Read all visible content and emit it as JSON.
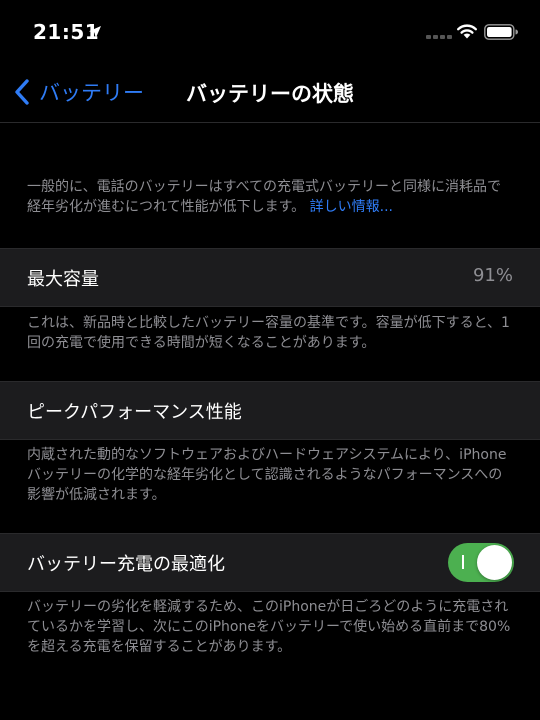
{
  "status_bar": {
    "time": "21:51"
  },
  "nav": {
    "back_label": "バッテリー",
    "title": "バッテリーの状態"
  },
  "intro": {
    "text": "一般的に、電話のバッテリーはすべての充電式バッテリーと同様に消耗品で経年劣化が進むにつれて性能が低下します。",
    "link": "詳しい情報..."
  },
  "max_capacity": {
    "label": "最大容量",
    "value": "91%",
    "description": "これは、新品時と比較したバッテリー容量の基準です。容量が低下すると、1回の充電で使用できる時間が短くなることがあります。"
  },
  "peak_performance": {
    "label": "ピークパフォーマンス性能",
    "description": "内蔵された動的なソフトウェアおよびハードウェアシステムにより、iPhoneバッテリーの化学的な経年劣化として認識されるようなパフォーマンスへの影響が低減されます。"
  },
  "optimized_charging": {
    "label": "バッテリー充電の最適化",
    "enabled": true,
    "description": "バッテリーの劣化を軽減するため、このiPhoneが日ごろどのように充電されているかを学習し、次にこのiPhoneをバッテリーで使い始める直前まで80%を超える充電を保留することがあります。"
  },
  "colors": {
    "accent": "#2f7cf6",
    "toggle_on": "#4cb050",
    "background": "#000000",
    "cell_background": "#1c1c1e",
    "secondary_text": "#8e8e93"
  },
  "icons": [
    "location-arrow-icon",
    "cellular-signal-icon",
    "wifi-icon",
    "battery-icon",
    "chevron-left-icon"
  ]
}
